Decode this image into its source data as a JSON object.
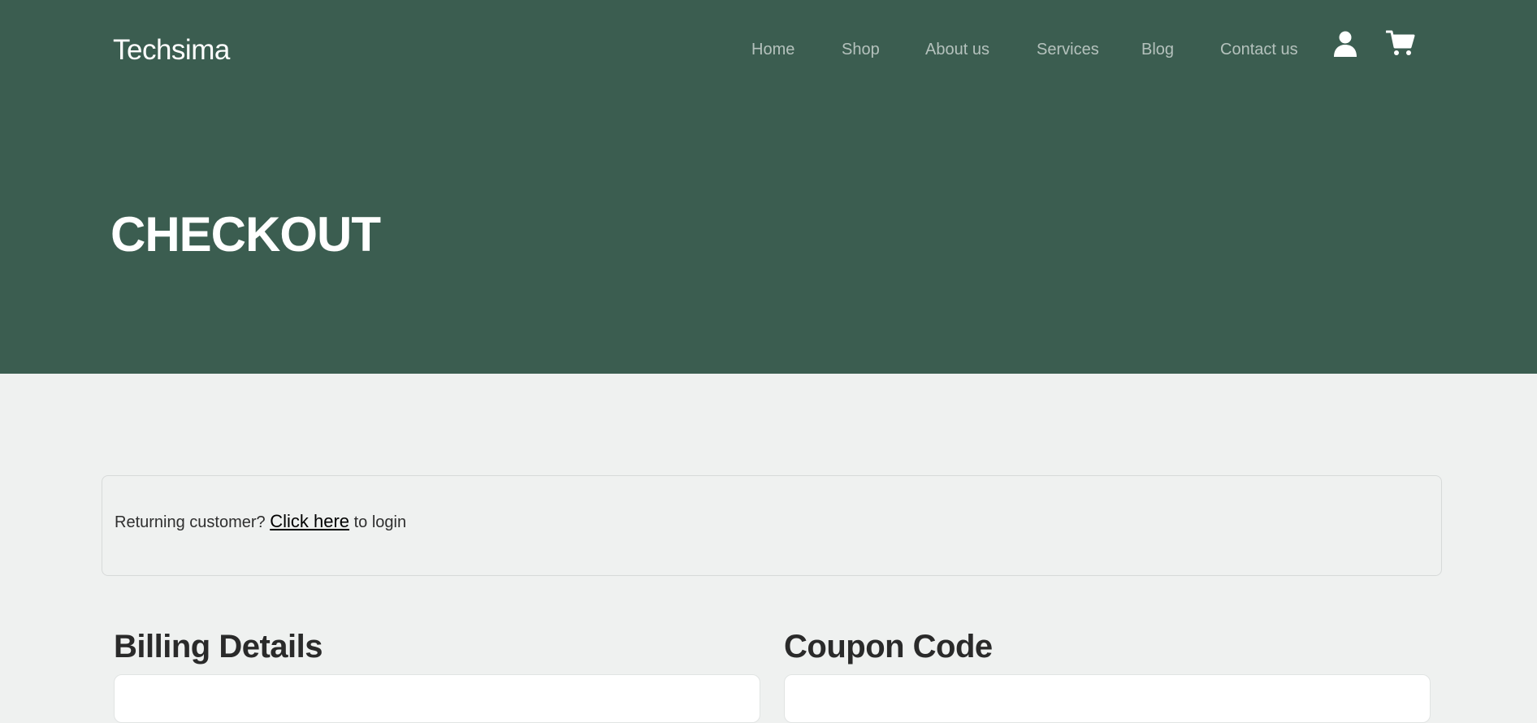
{
  "header": {
    "brand": "Techsima",
    "nav": [
      "Home",
      "Shop",
      "About us",
      "Services",
      "Blog",
      "Contact us"
    ],
    "icons": [
      "user-icon",
      "cart-icon"
    ]
  },
  "hero": {
    "title": "CHECKOUT"
  },
  "login_notice": {
    "prefix": "Returning customer?",
    "link": "Click here",
    "suffix": "to login"
  },
  "billing": {
    "title": "Billing Details"
  },
  "coupon": {
    "title": "Coupon Code"
  },
  "colors": {
    "hero_bg": "#3b5d50",
    "page_bg": "#eff1f0",
    "panel_bg": "#ffffff"
  }
}
